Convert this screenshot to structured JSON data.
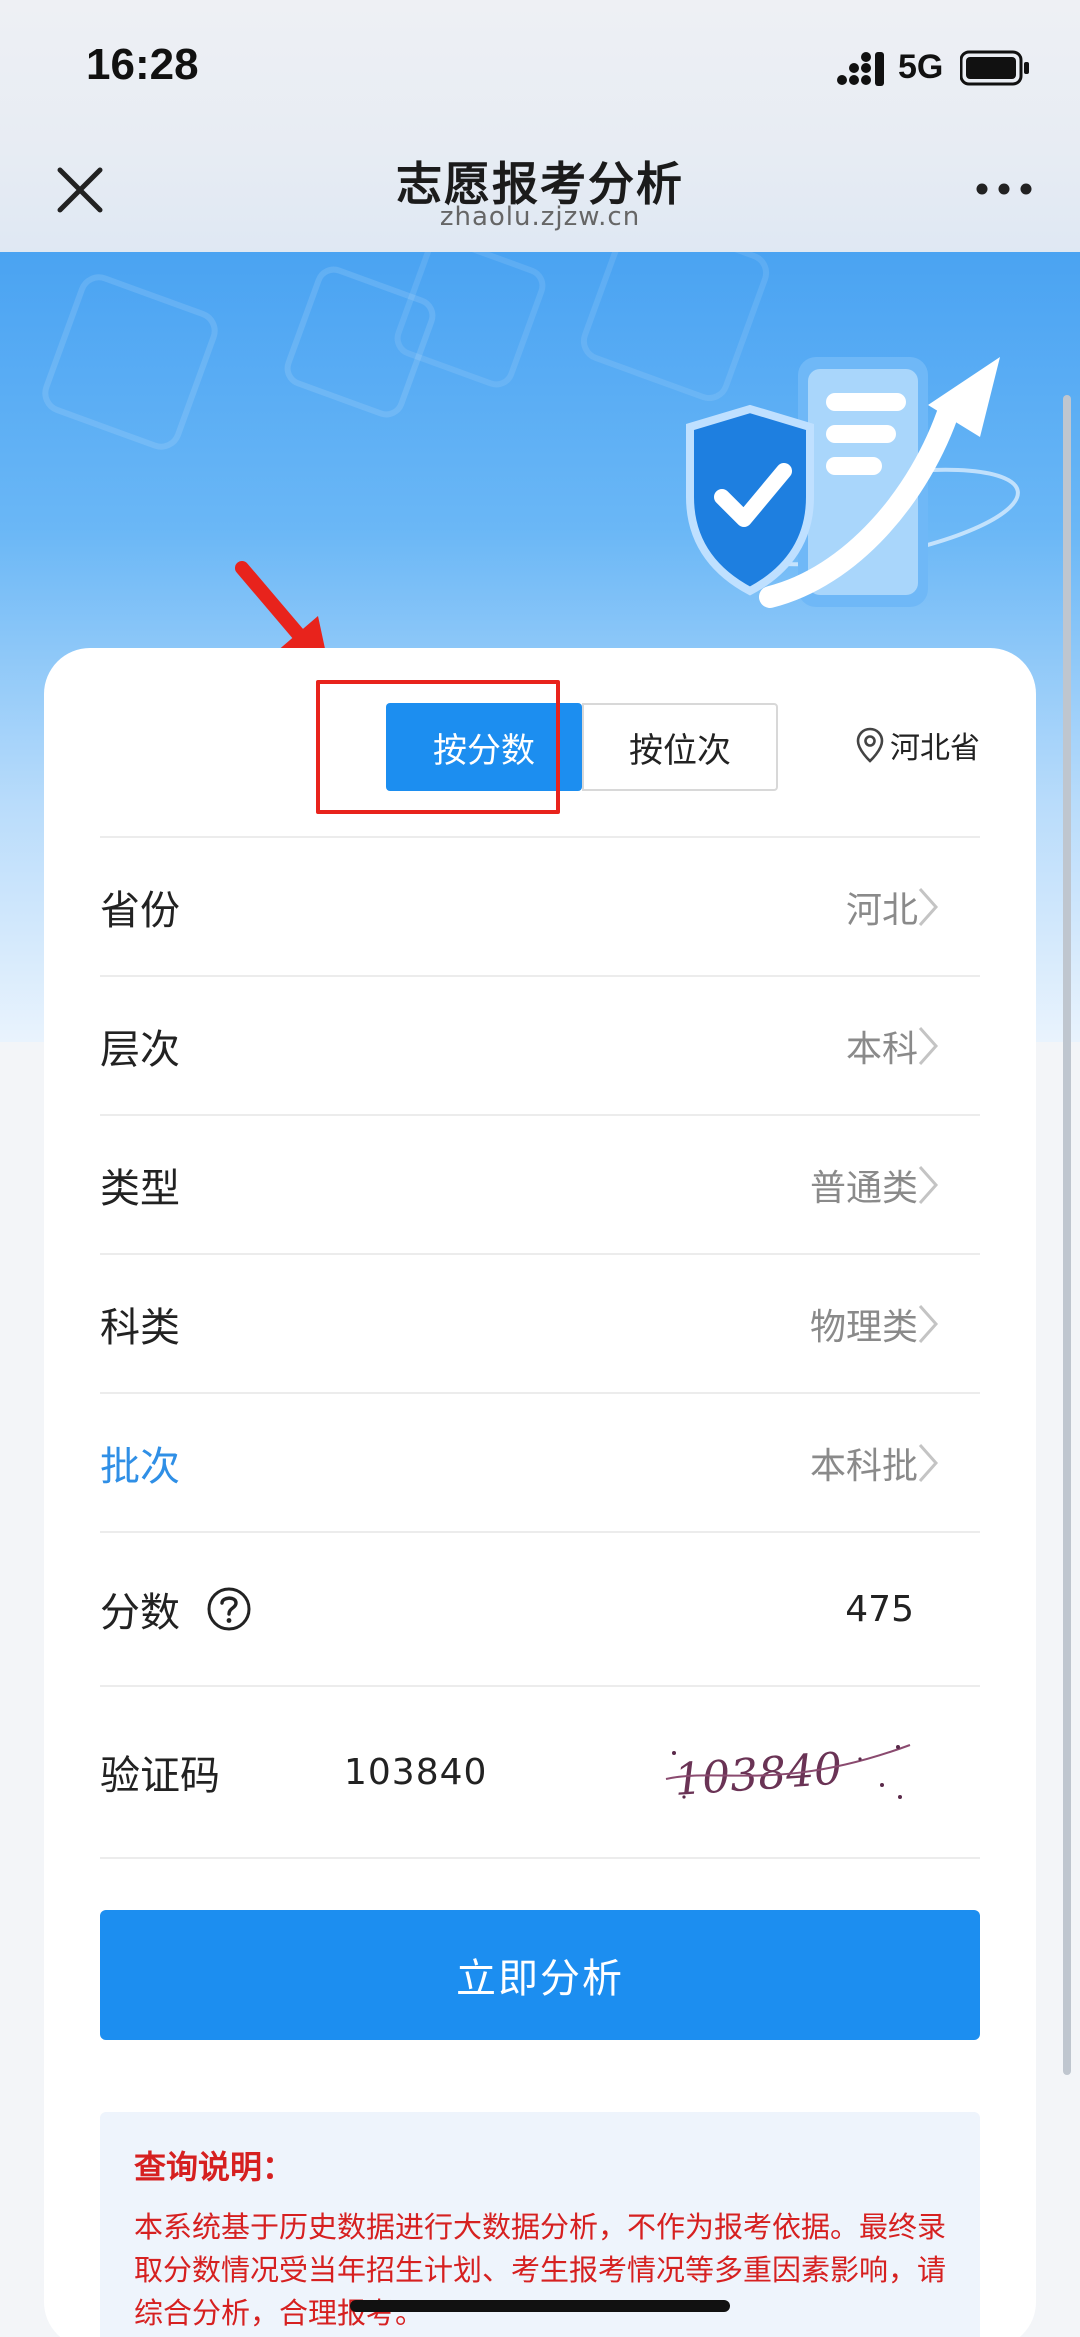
{
  "status_bar": {
    "time": "16:28",
    "network": "5G"
  },
  "nav": {
    "title": "志愿报考分析",
    "subtitle": "zhaolu.zjzw.cn"
  },
  "tabs": {
    "by_score": "按分数",
    "by_rank": "按位次"
  },
  "location": "河北省",
  "rows": [
    {
      "label": "省份",
      "value": "河北"
    },
    {
      "label": "层次",
      "value": "本科"
    },
    {
      "label": "类型",
      "value": "普通类"
    },
    {
      "label": "科类",
      "value": "物理类"
    },
    {
      "label": "批次",
      "value": "本科批"
    }
  ],
  "score": {
    "label": "分数",
    "value": "475"
  },
  "captcha": {
    "label": "验证码",
    "value": "103840",
    "image_text": "103840"
  },
  "analyze_button": "立即分析",
  "note": {
    "title": "查询说明：",
    "body": "本系统基于历史数据进行大数据分析，不作为报考依据。最终录取分数情况受当年招生计划、考生报考情况等多重因素影响，请综合分析，合理报考。"
  },
  "colors": {
    "primary": "#1c8ef0",
    "active_label": "#2f8fe6",
    "warning": "#d62020",
    "annotation": "#e8231c"
  }
}
